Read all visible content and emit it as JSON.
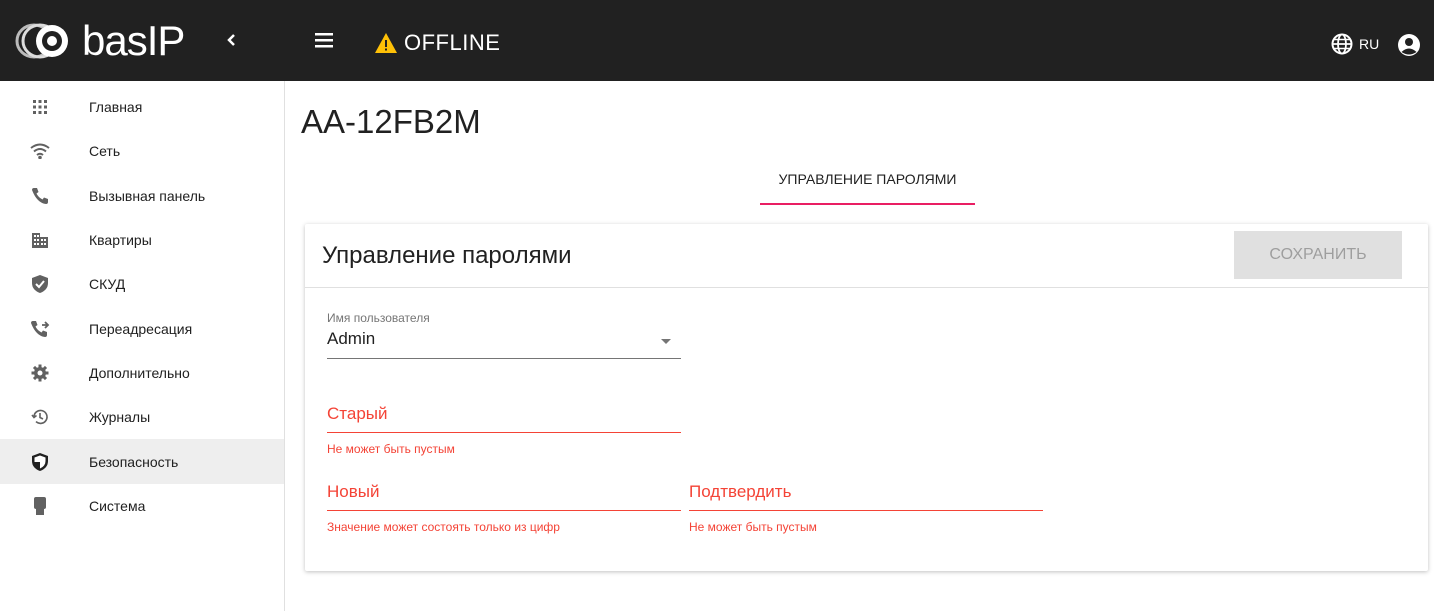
{
  "header": {
    "logo_text": "basIP",
    "status_text": "OFFLINE",
    "language": "RU"
  },
  "sidebar": {
    "items": [
      {
        "label": "Главная",
        "icon": "grid-icon"
      },
      {
        "label": "Сеть",
        "icon": "wifi-icon"
      },
      {
        "label": "Вызывная панель",
        "icon": "phone-icon"
      },
      {
        "label": "Квартиры",
        "icon": "building-icon"
      },
      {
        "label": "СКУД",
        "icon": "shield-check-icon"
      },
      {
        "label": "Переадресация",
        "icon": "phone-forward-icon"
      },
      {
        "label": "Дополнительно",
        "icon": "gear-icon"
      },
      {
        "label": "Журналы",
        "icon": "history-icon"
      },
      {
        "label": "Безопасность",
        "icon": "security-shield-icon",
        "active": true
      },
      {
        "label": "Система",
        "icon": "chip-icon"
      }
    ]
  },
  "main": {
    "title": "AA-12FB2M",
    "tab": "УПРАВЛЕНИЕ ПАРОЛЯМИ",
    "card": {
      "title": "Управление паролями",
      "save_label": "СОХРАНИТЬ",
      "username_label": "Имя пользователя",
      "username_value": "Admin",
      "old_label": "Старый",
      "old_error": "Не может быть пустым",
      "new_label": "Новый",
      "new_error": "Значение может состоять только из цифр",
      "confirm_label": "Подтвердить",
      "confirm_error": "Не может быть пустым"
    }
  },
  "colors": {
    "topbar": "#212121",
    "accent": "#e91e63",
    "error": "#f44336",
    "warning": "#ffc107"
  }
}
